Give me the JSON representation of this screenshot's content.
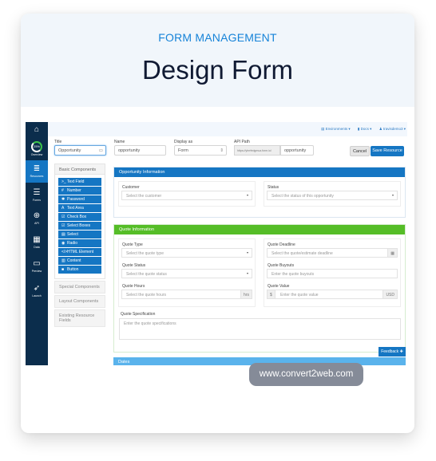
{
  "hero": {
    "eyebrow": "FORM MANAGEMENT",
    "title": "Design Form"
  },
  "colors": {
    "accent": "#1576c3",
    "rail": "#0b2d4c",
    "quote_header": "#55bd27",
    "dates_header": "#5ab3ec",
    "eyebrow": "#1683d8"
  },
  "rail": {
    "home_icon": "home-icon",
    "items": [
      {
        "label": "Overview",
        "icon": "gauge-icon",
        "gauge_text": "25%"
      },
      {
        "label": "Resources",
        "icon": "database-icon",
        "glyph": "≣"
      },
      {
        "label": "Forms",
        "icon": "forms-icon",
        "glyph": "☰"
      },
      {
        "label": "API",
        "icon": "api-icon",
        "glyph": "⊕"
      },
      {
        "label": "Data",
        "icon": "grid-icon",
        "glyph": "▦"
      },
      {
        "label": "Preview",
        "icon": "laptop-icon",
        "glyph": "▭"
      },
      {
        "label": "Launch",
        "icon": "rocket-icon",
        "glyph": "➶"
      }
    ]
  },
  "topnav": {
    "environments": "▤ Environments ▾",
    "docs": "▮ Docs ▾",
    "user": "♟ travisdemo3 ▾"
  },
  "form": {
    "title_label": "Title",
    "title_value": "Opportunity",
    "name_label": "Name",
    "name_value": "opportunity",
    "display_label": "Display as",
    "display_value": "Form",
    "api_label": "API Path",
    "api_prefix": "https://yhrrfedgmua.form.io/",
    "api_value": "opportunity",
    "cancel": "Cancel",
    "save": "Save Resource"
  },
  "palette": {
    "basic_header": "Basic Components",
    "items": [
      {
        "glyph": ">_",
        "label": "Text Field"
      },
      {
        "glyph": "#",
        "label": "Number"
      },
      {
        "glyph": "✱",
        "label": "Password"
      },
      {
        "glyph": "A",
        "label": "Text Area"
      },
      {
        "glyph": "☑",
        "label": "Check Box"
      },
      {
        "glyph": "☑",
        "label": "Select Boxes"
      },
      {
        "glyph": "▤",
        "label": "Select"
      },
      {
        "glyph": "◉",
        "label": "Radio"
      },
      {
        "glyph": "</>",
        "label": "HTML Element"
      },
      {
        "glyph": "▥",
        "label": "Content"
      },
      {
        "glyph": "■",
        "label": "Button"
      }
    ],
    "groups": [
      "Special Components",
      "Layout Components",
      "Existing Resource Fields"
    ]
  },
  "opportunity_panel": {
    "header": "Opportunity Information",
    "customer_label": "Customer",
    "customer_placeholder": "Select the customer",
    "status_label": "Status",
    "status_placeholder": "Select the status of this opportunity"
  },
  "quote_panel": {
    "header": "Quote Information",
    "type_label": "Quote Type",
    "type_placeholder": "Select the quote type",
    "status_label": "Quote Status",
    "status_placeholder": "Select the quote status",
    "hours_label": "Quote Hours",
    "hours_placeholder": "Select the quote hours",
    "hours_suffix": "hrs",
    "deadline_label": "Quote Deadline",
    "deadline_placeholder": "Select the quote/estimate deadline",
    "buyouts_label": "Quote Buyouts",
    "buyouts_placeholder": "Enter the quote buyouts",
    "value_label": "Quote Value",
    "value_prefix": "$",
    "value_placeholder": "Enter the quote value",
    "value_suffix": "USD",
    "spec_label": "Quote Specification",
    "spec_placeholder": "Enter the quote specifications"
  },
  "dates_panel": {
    "header": "Dates"
  },
  "feedback": "Feedback ✚",
  "footer": {
    "url": "www.convert2web.com"
  }
}
